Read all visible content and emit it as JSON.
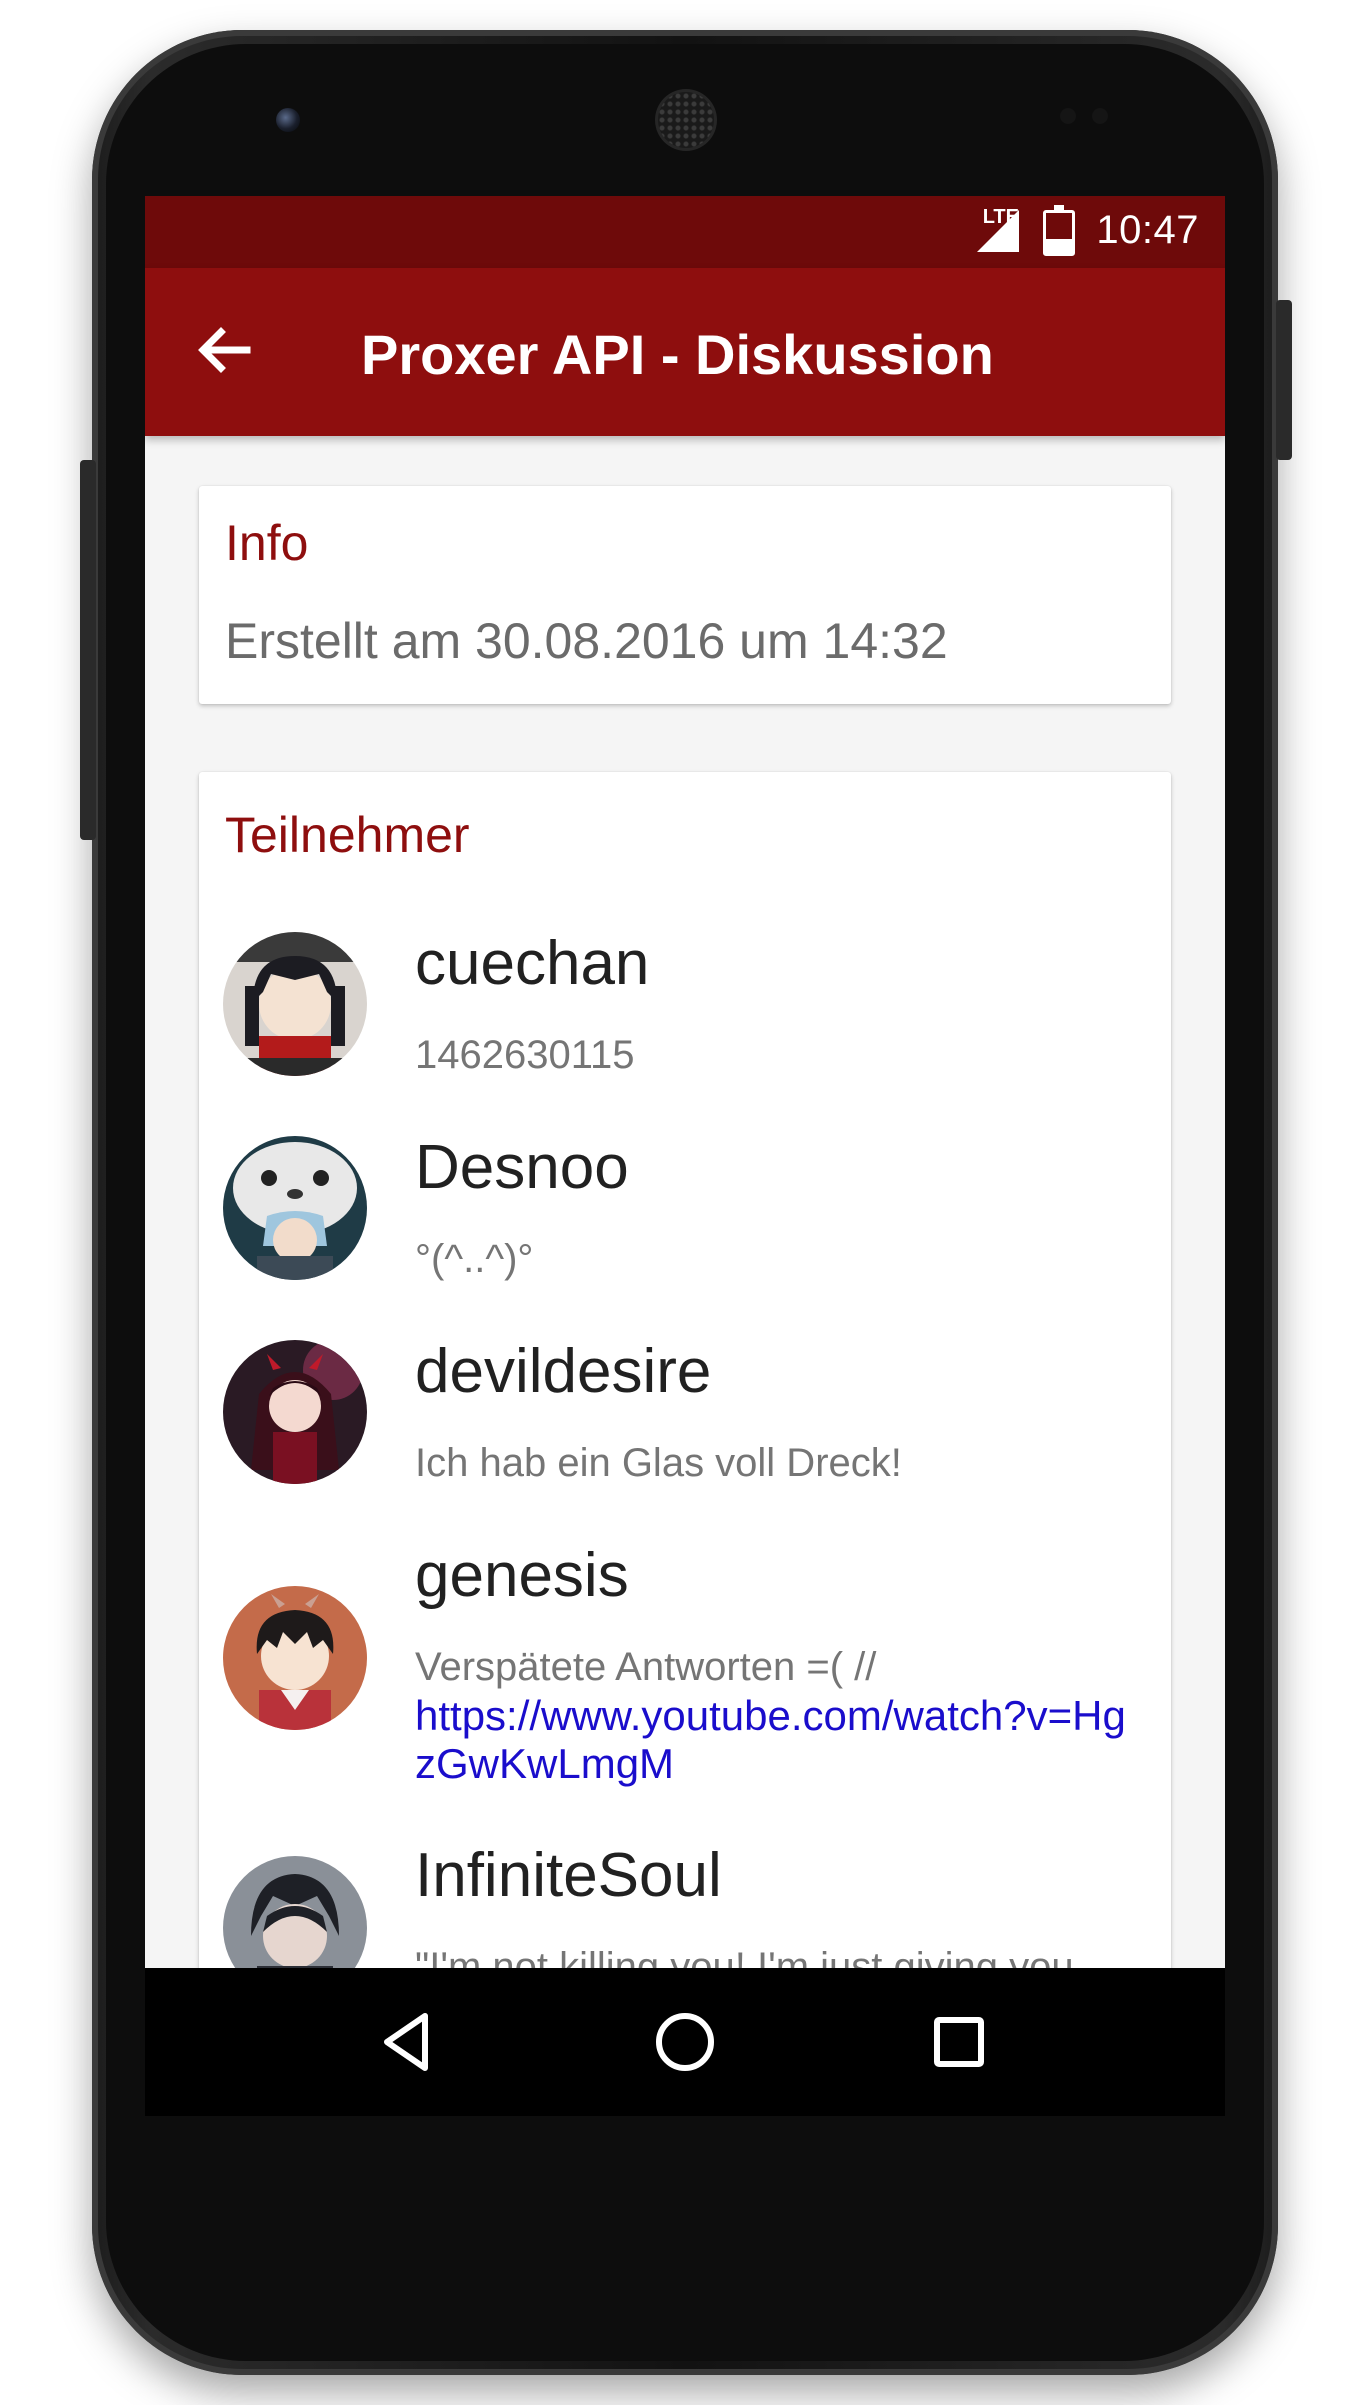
{
  "status_bar": {
    "time": "10:47",
    "network": "LTE",
    "background_color": "#6e0a0a"
  },
  "toolbar": {
    "title": "Proxer API - Diskussion",
    "back_icon": "arrow-back-icon",
    "background_color": "#8e0e0e"
  },
  "info": {
    "title": "Info",
    "created": "Erstellt am 30.08.2016 um 14:32"
  },
  "participants": {
    "title": "Teilnehmer",
    "items": [
      {
        "name": "cuechan",
        "status": "1462630115",
        "link": ""
      },
      {
        "name": "Desnoo",
        "status": "°(^..^)°",
        "link": ""
      },
      {
        "name": "devildesire",
        "status": "Ich hab ein Glas voll Dreck!",
        "link": ""
      },
      {
        "name": "genesis",
        "status": "Verspätete Antworten =(  //",
        "link": "https://www.youtube.com/watch?v=HgzGwKwLmgM"
      },
      {
        "name": "InfiniteSoul",
        "status": "\"I'm not killing you! I'm just giving you",
        "link": ""
      }
    ]
  },
  "nav_bar": {
    "back_icon": "nav-back-icon",
    "home_icon": "nav-home-icon",
    "recents_icon": "nav-recents-icon"
  },
  "colors": {
    "accent": "#8e0e0e",
    "link": "#1a0dcc"
  }
}
